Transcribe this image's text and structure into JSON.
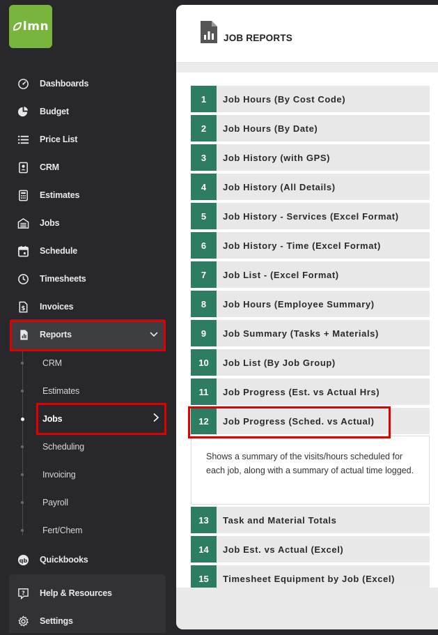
{
  "brand": {
    "logo_text": "lmn",
    "logo_color": "#79b43d"
  },
  "sidebar": {
    "items": [
      {
        "label": "Dashboards",
        "icon": "dashboard-gauge-icon"
      },
      {
        "label": "Budget",
        "icon": "pie-chart-icon"
      },
      {
        "label": "Price List",
        "icon": "list-icon"
      },
      {
        "label": "CRM",
        "icon": "contact-card-icon"
      },
      {
        "label": "Estimates",
        "icon": "calculator-icon"
      },
      {
        "label": "Jobs",
        "icon": "garage-icon"
      },
      {
        "label": "Schedule",
        "icon": "calendar-icon"
      },
      {
        "label": "Timesheets",
        "icon": "clock-icon"
      },
      {
        "label": "Invoices",
        "icon": "invoice-icon"
      }
    ],
    "reports": {
      "label": "Reports",
      "icon": "report-icon",
      "expanded": true
    },
    "reports_sub": [
      {
        "label": "CRM"
      },
      {
        "label": "Estimates"
      },
      {
        "label": "Jobs",
        "active": true
      },
      {
        "label": "Scheduling"
      },
      {
        "label": "Invoicing"
      },
      {
        "label": "Payroll"
      },
      {
        "label": "Fert/Chem"
      }
    ],
    "quickbooks": {
      "label": "Quickbooks",
      "icon": "quickbooks-icon"
    },
    "help": {
      "label": "Help & Resources",
      "icon": "help-icon"
    },
    "settings": {
      "label": "Settings",
      "icon": "gear-icon"
    }
  },
  "main": {
    "title": "JOB REPORTS",
    "reports": [
      {
        "num": "1",
        "label": "Job Hours (By Cost Code)"
      },
      {
        "num": "2",
        "label": "Job Hours (By Date)"
      },
      {
        "num": "3",
        "label": "Job History (with GPS)"
      },
      {
        "num": "4",
        "label": "Job History (All Details)"
      },
      {
        "num": "5",
        "label": "Job History - Services (Excel Format)"
      },
      {
        "num": "6",
        "label": "Job History - Time (Excel Format)"
      },
      {
        "num": "7",
        "label": "Job List - (Excel Format)"
      },
      {
        "num": "8",
        "label": "Job Hours (Employee Summary)"
      },
      {
        "num": "9",
        "label": "Job Summary (Tasks + Materials)"
      },
      {
        "num": "10",
        "label": "Job List (By Job Group)"
      },
      {
        "num": "11",
        "label": "Job Progress (Est. vs Actual Hrs)"
      },
      {
        "num": "12",
        "label": "Job Progress (Sched. vs Actual)"
      },
      {
        "num": "13",
        "label": "Task and Material Totals"
      },
      {
        "num": "14",
        "label": "Job Est. vs Actual (Excel)"
      },
      {
        "num": "15",
        "label": "Timesheet Equipment by Job (Excel)"
      }
    ],
    "expanded_description": "Shows a summary of the visits/hours scheduled for each job, along with a summary of actual time logged."
  },
  "colors": {
    "accent_green": "#2c7d62",
    "highlight_red": "#e00000",
    "sidebar_bg": "#28282c"
  }
}
